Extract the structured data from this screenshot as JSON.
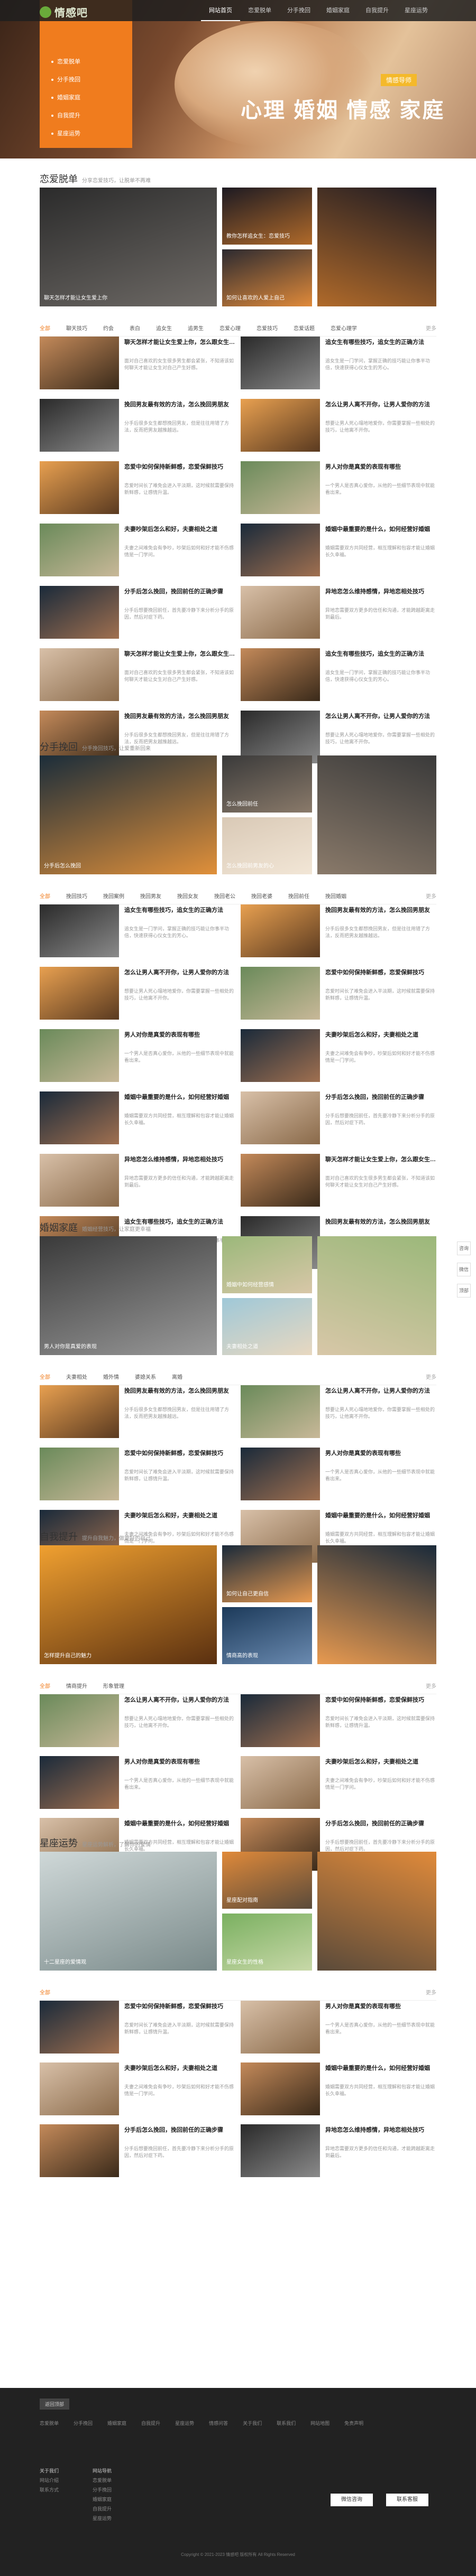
{
  "site": {
    "logo": "情感吧"
  },
  "nav": [
    "网站首页",
    "恋爱脱单",
    "分手挽回",
    "婚姻家庭",
    "自我提升",
    "星座运势"
  ],
  "hero": {
    "side_menu": [
      "恋爱脱单",
      "分手挽回",
      "婚姻家庭",
      "自我提升",
      "星座运势"
    ],
    "tag": "情感导师",
    "slogan": "心理 婚姻 情感 家庭"
  },
  "sections": [
    {
      "title": "恋爱脱单",
      "subtitle": "分享恋爱技巧，让脱单不再难",
      "captions": [
        "聊天怎样才能让女生爱上你",
        "教你怎样追女生：恋爱技巧",
        "如何让喜欢的人爱上自己"
      ],
      "tabs": [
        "全部",
        "聊天技巧",
        "约会",
        "表白",
        "追女生",
        "追男生",
        "恋爱心理",
        "恋爱技巧",
        "恋爱话题",
        "恋爱心理学",
        "更多"
      ]
    },
    {
      "title": "分手挽回",
      "subtitle": "分手挽回技巧，让爱重新回来",
      "captions": [
        "分手后怎么挽回",
        "怎么挽回前任",
        "怎么挽回前男友的心"
      ],
      "tabs": [
        "全部",
        "挽回技巧",
        "挽回案例",
        "挽回男友",
        "挽回女友",
        "挽回老公",
        "挽回老婆",
        "挽回前任",
        "挽回婚姻",
        "更多"
      ]
    },
    {
      "title": "婚姻家庭",
      "subtitle": "婚姻经营技巧，让家庭更幸福",
      "captions": [
        "男人对你是真爱的表现",
        "婚姻中如何经营感情",
        "夫妻相处之道"
      ],
      "tabs": [
        "全部",
        "夫妻相处",
        "婚外情",
        "婆媳关系",
        "离婚",
        "更多"
      ]
    },
    {
      "title": "自我提升",
      "subtitle": "提升自我魅力，做更好的自己",
      "captions": [
        "怎样提升自己的魅力",
        "如何让自己更自信",
        "情商高的表现"
      ],
      "tabs": [
        "全部",
        "情商提升",
        "形象管理",
        "更多"
      ]
    },
    {
      "title": "星座运势",
      "subtitle": "星座运势解析，了解你的爱情",
      "captions": [
        "十二星座的爱情观",
        "星座配对指南",
        "星座女生的性格"
      ],
      "tabs": [
        "全部",
        "更多"
      ]
    }
  ],
  "articles": [
    [
      "聊天怎样才能让女生爱上你，怎么跟女生聊天",
      "面对自己喜欢的女生很多男生都会紧张，不知道该如何聊天才能让女生对自己产生好感。"
    ],
    [
      "追女生有哪些技巧，追女生的正确方法",
      "追女生是一门学问，掌握正确的技巧能让你事半功倍，快速获得心仪女生的芳心。"
    ],
    [
      "挽回男友最有效的方法，怎么挽回男朋友",
      "分手后很多女生都想挽回男友，但是往往用错了方法，反而把男友越推越远。"
    ],
    [
      "怎么让男人离不开你，让男人爱你的方法",
      "想要让男人死心塌地地爱你，你需要掌握一些相处的技巧，让他离不开你。"
    ],
    [
      "恋爱中如何保持新鲜感，恋爱保鲜技巧",
      "恋爱时间长了难免会进入平淡期，这时候就需要保持新鲜感，让感情升温。"
    ],
    [
      "男人对你是真爱的表现有哪些",
      "一个男人是否真心爱你，从他的一些细节表现中就能看出来。"
    ],
    [
      "夫妻吵架后怎么和好，夫妻相处之道",
      "夫妻之间难免会有争吵，吵架后如何和好才能不伤感情是一门学问。"
    ],
    [
      "婚姻中最重要的是什么，如何经营好婚姻",
      "婚姻需要双方共同经营，相互理解和包容才能让婚姻长久幸福。"
    ],
    [
      "分手后怎么挽回，挽回前任的正确步骤",
      "分手后想要挽回前任，首先要冷静下来分析分手的原因，然后对症下药。"
    ],
    [
      "异地恋怎么维持感情，异地恋相处技巧",
      "异地恋需要双方更多的信任和沟通，才能跨越距离走到最后。"
    ]
  ],
  "footer": {
    "button": "返回顶部",
    "links": [
      "恋爱脱单",
      "分手挽回",
      "婚姻家庭",
      "自我提升",
      "星座运势",
      "情感问答",
      "关于我们",
      "联系我们",
      "网站地图",
      "免责声明"
    ],
    "col1_title": "关于我们",
    "col1": [
      "网站介绍",
      "联系方式"
    ],
    "col2_title": "网站导航",
    "col2": [
      "恋爱脱单",
      "分手挽回",
      "婚姻家庭",
      "自我提升",
      "星座运势"
    ],
    "btn_a": "微信咨询",
    "btn_b": "联系客服",
    "copyright": "Copyright © 2021-2023 情感吧 版权所有 All Rights Reserved"
  },
  "floats": [
    "咨询",
    "微信",
    "顶部"
  ],
  "colors": {
    "accent": "#f07c1e",
    "footer": "#222222"
  }
}
